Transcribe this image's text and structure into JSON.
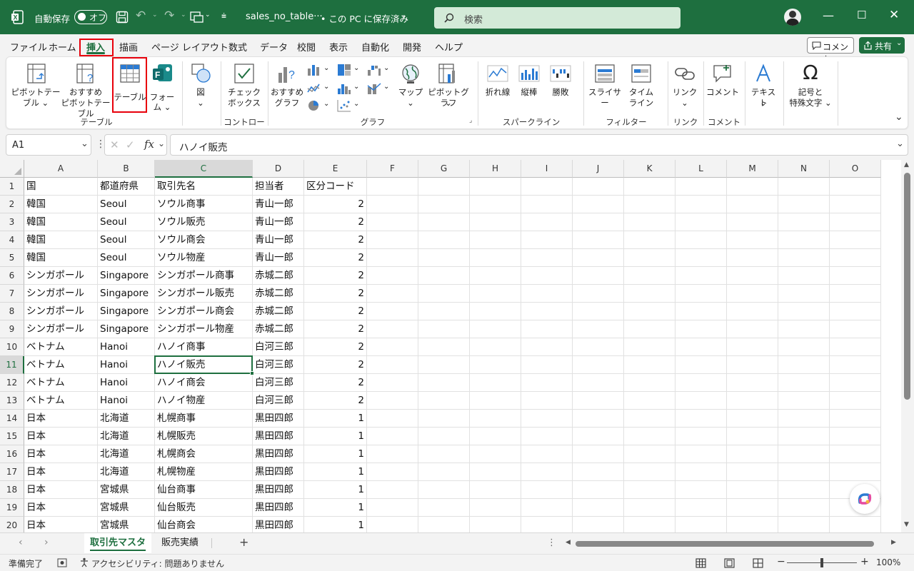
{
  "titlebar": {
    "autosave_label": "自動保存",
    "autosave_state": "オフ",
    "filename": "sales_no_table···",
    "save_status": "• この PC に保存済み",
    "search_placeholder": "検索"
  },
  "menu": {
    "items": [
      "ファイル",
      "ホーム",
      "挿入",
      "描画",
      "ページ レイアウト",
      "数式",
      "データ",
      "校閲",
      "表示",
      "自動化",
      "開発",
      "ヘルプ"
    ],
    "comment_button": "コメント",
    "share_button": "共有"
  },
  "ribbon": {
    "groups": {
      "table": "テーブル",
      "control": "コントロール",
      "graph": "グラフ",
      "sparkline": "スパークライン",
      "filter": "フィルター",
      "link": "リンク",
      "comment": "コメント"
    },
    "buttons": {
      "pivot1": "ピボットテー",
      "pivot2": "ブル",
      "rec_pivot1": "おすすめ",
      "rec_pivot2": "ピボットテーブル",
      "table": "テーブル",
      "form1": "フォー",
      "form2": "ム",
      "figure": "図",
      "checkbox1": "チェック",
      "checkbox2": "ボックス",
      "rec_graph1": "おすすめ",
      "rec_graph2": "グラフ",
      "map": "マップ",
      "pivot_graph": "ピボットグラフ",
      "line": "折れ線",
      "column": "縦棒",
      "winloss": "勝敗",
      "slicer": "スライサー",
      "timeline1": "タイム",
      "timeline2": "ライン",
      "link": "リンク",
      "comment": "コメント",
      "text": "テキスト",
      "symbol1": "記号と",
      "symbol2": "特殊文字"
    }
  },
  "formula_bar": {
    "name_box": "A1",
    "fx": "fx",
    "content": "ハノイ販売"
  },
  "columns": [
    "A",
    "B",
    "C",
    "D",
    "E",
    "F",
    "G",
    "H",
    "I",
    "J",
    "K",
    "L",
    "M",
    "N",
    "O"
  ],
  "rows": [
    {
      "num": "1",
      "a": "国",
      "b": "都道府県",
      "c": "取引先名",
      "d": "担当者",
      "e": "区分コード"
    },
    {
      "num": "2",
      "a": "韓国",
      "b": "Seoul",
      "c": "ソウル商事",
      "d": "青山一郎",
      "e": "2"
    },
    {
      "num": "3",
      "a": "韓国",
      "b": "Seoul",
      "c": "ソウル販売",
      "d": "青山一郎",
      "e": "2"
    },
    {
      "num": "4",
      "a": "韓国",
      "b": "Seoul",
      "c": "ソウル商会",
      "d": "青山一郎",
      "e": "2"
    },
    {
      "num": "5",
      "a": "韓国",
      "b": "Seoul",
      "c": "ソウル物産",
      "d": "青山一郎",
      "e": "2"
    },
    {
      "num": "6",
      "a": "シンガポール",
      "b": "Singapore",
      "c": "シンガポール商事",
      "d": "赤城二郎",
      "e": "2"
    },
    {
      "num": "7",
      "a": "シンガポール",
      "b": "Singapore",
      "c": "シンガポール販売",
      "d": "赤城二郎",
      "e": "2"
    },
    {
      "num": "8",
      "a": "シンガポール",
      "b": "Singapore",
      "c": "シンガポール商会",
      "d": "赤城二郎",
      "e": "2"
    },
    {
      "num": "9",
      "a": "シンガポール",
      "b": "Singapore",
      "c": "シンガポール物産",
      "d": "赤城二郎",
      "e": "2"
    },
    {
      "num": "10",
      "a": "ベトナム",
      "b": "Hanoi",
      "c": "ハノイ商事",
      "d": "白河三郎",
      "e": "2"
    },
    {
      "num": "11",
      "a": "ベトナム",
      "b": "Hanoi",
      "c": "ハノイ販売",
      "d": "白河三郎",
      "e": "2"
    },
    {
      "num": "12",
      "a": "ベトナム",
      "b": "Hanoi",
      "c": "ハノイ商会",
      "d": "白河三郎",
      "e": "2"
    },
    {
      "num": "13",
      "a": "ベトナム",
      "b": "Hanoi",
      "c": "ハノイ物産",
      "d": "白河三郎",
      "e": "2"
    },
    {
      "num": "14",
      "a": "日本",
      "b": "北海道",
      "c": "札幌商事",
      "d": "黒田四郎",
      "e": "1"
    },
    {
      "num": "15",
      "a": "日本",
      "b": "北海道",
      "c": "札幌販売",
      "d": "黒田四郎",
      "e": "1"
    },
    {
      "num": "16",
      "a": "日本",
      "b": "北海道",
      "c": "札幌商会",
      "d": "黒田四郎",
      "e": "1"
    },
    {
      "num": "17",
      "a": "日本",
      "b": "北海道",
      "c": "札幌物産",
      "d": "黒田四郎",
      "e": "1"
    },
    {
      "num": "18",
      "a": "日本",
      "b": "宮城県",
      "c": "仙台商事",
      "d": "黒田四郎",
      "e": "1"
    },
    {
      "num": "19",
      "a": "日本",
      "b": "宮城県",
      "c": "仙台販売",
      "d": "黒田四郎",
      "e": "1"
    },
    {
      "num": "20",
      "a": "日本",
      "b": "宮城県",
      "c": "仙台商会",
      "d": "黒田四郎",
      "e": "1"
    }
  ],
  "sheets": {
    "active": "取引先マスタ",
    "other": "販売実績",
    "add": "+"
  },
  "status": {
    "ready": "準備完了",
    "accessibility": "アクセシビリティ: 問題ありません",
    "zoom": "100%"
  },
  "colors": {
    "excel_green": "#1e6f3f",
    "highlight_red": "#e8000b"
  }
}
